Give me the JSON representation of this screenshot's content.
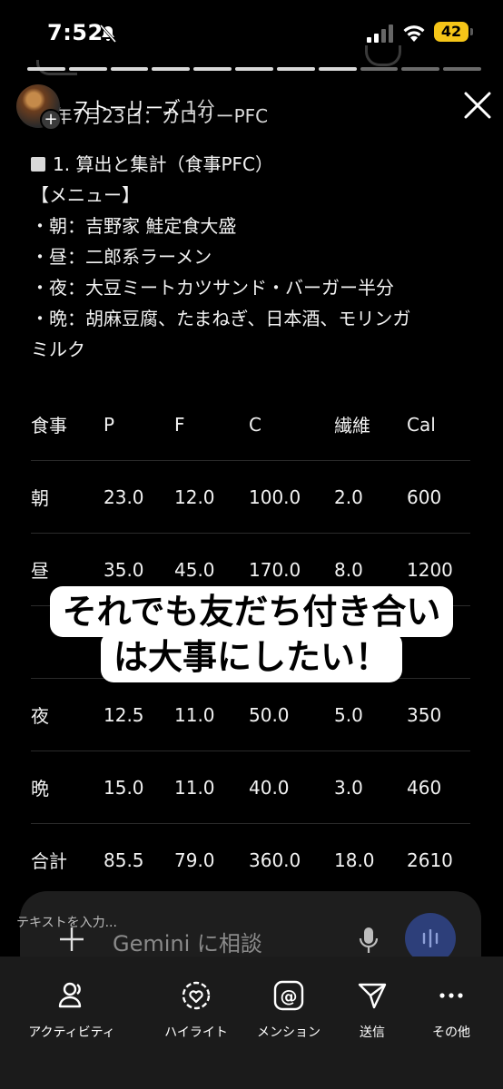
{
  "status_bar": {
    "time": "7:52",
    "battery": "42"
  },
  "story": {
    "user": "ストーリーズ",
    "time_ago": "1分",
    "progress": {
      "segments": 11,
      "completed": 8
    }
  },
  "doc": {
    "title": "26年7月23日：カロリーPFC",
    "heading": "1. 算出と集計（食事PFC）",
    "menu_label": "【メニュー】",
    "menu": [
      "・朝：吉野家 鮭定食大盛",
      "・昼：二郎系ラーメン",
      "・夜：大豆ミートカツサンド・バーガー半分",
      "・晩：胡麻豆腐、たまねぎ、日本酒、モリンガ",
      "ミルク"
    ]
  },
  "table": {
    "headers": [
      "食事",
      "P",
      "F",
      "C",
      "繊維",
      "Cal"
    ],
    "rows": [
      [
        "朝",
        "23.0",
        "12.0",
        "100.0",
        "2.0",
        "600"
      ],
      [
        "昼",
        "35.0",
        "45.0",
        "170.0",
        "8.0",
        "1200"
      ],
      [
        "",
        "",
        "",
        "",
        "",
        ""
      ],
      [
        "夜",
        "12.5",
        "11.0",
        "50.0",
        "5.0",
        "350"
      ],
      [
        "晩",
        "15.0",
        "11.0",
        "40.0",
        "3.0",
        "460"
      ],
      [
        "合計",
        "85.5",
        "79.0",
        "360.0",
        "18.0",
        "2610"
      ]
    ]
  },
  "caption": {
    "line1": "それでも友だち付き合い",
    "line2": "は大事にしたい！"
  },
  "input": {
    "hint": "テキストを入力...",
    "gemini_placeholder": "Gemini に相談"
  },
  "nav": {
    "items": [
      {
        "label": "アクティビティ",
        "icon": "activity-icon"
      },
      {
        "label": "ハイライト",
        "icon": "highlight-icon"
      },
      {
        "label": "メンション",
        "icon": "mention-icon"
      },
      {
        "label": "送信",
        "icon": "send-icon"
      },
      {
        "label": "その他",
        "icon": "more-icon"
      }
    ]
  }
}
